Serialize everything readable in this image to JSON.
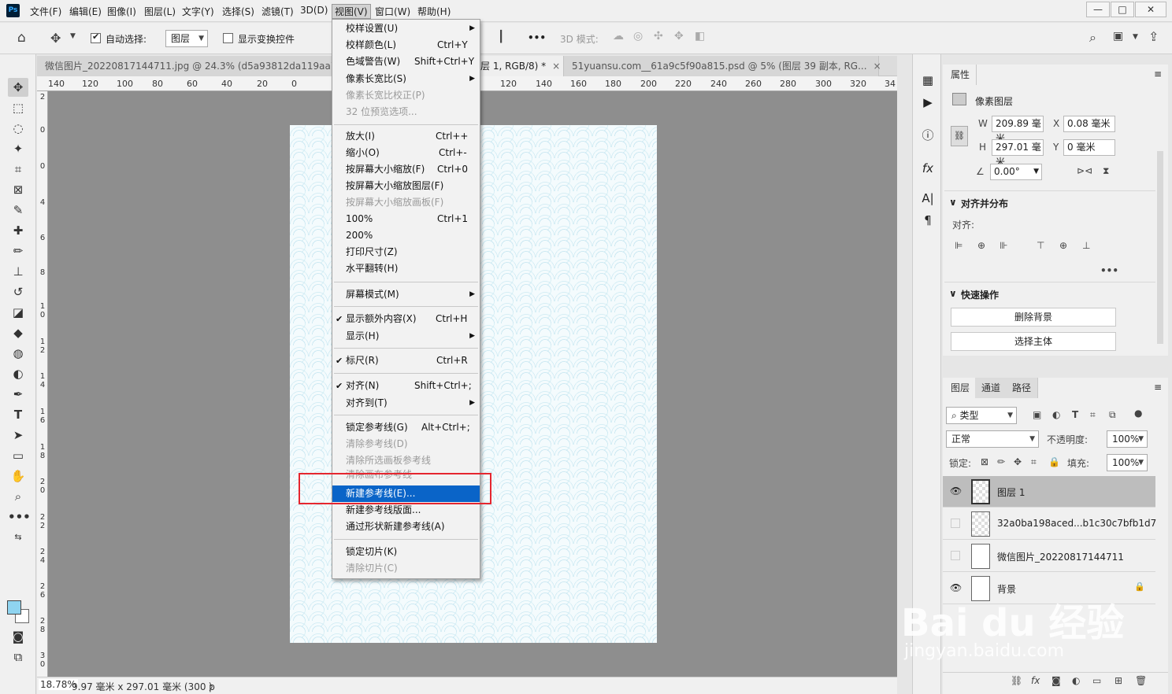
{
  "app": {
    "logo": "Ps"
  },
  "menubar": {
    "items": [
      "文件(F)",
      "编辑(E)",
      "图像(I)",
      "图层(L)",
      "文字(Y)",
      "选择(S)",
      "滤镜(T)",
      "3D(D)",
      "视图(V)",
      "窗口(W)",
      "帮助(H)"
    ],
    "active": "视图(V)"
  },
  "window_controls": {
    "minimize": "—",
    "maximize": "□",
    "close": "✕"
  },
  "options": {
    "move_icon": "✥",
    "auto_select_label": "自动选择:",
    "auto_select_value": "图层",
    "show_transform_label": "显示变换控件",
    "three_d_label": "3D 模式:",
    "more": "•••"
  },
  "tabs": [
    {
      "label": "微信图片_20220817144711.jpg @ 24.3% (d5a93812da119aa78...",
      "close": ""
    },
    {
      "label": "层 1, RGB/8) *",
      "close": "×"
    },
    {
      "label": "51yuansu.com__61a9c5f90a815.psd @ 5% (图层 39 副本, RG...",
      "close": "×"
    }
  ],
  "hruler": {
    "ticks_left": [
      "140",
      "120",
      "100",
      "80",
      "60",
      "40",
      "20",
      "0"
    ],
    "ticks_right": [
      "120",
      "140",
      "160",
      "180",
      "200",
      "220",
      "240",
      "260",
      "280",
      "300",
      "320",
      "34"
    ]
  },
  "vruler": {
    "ticks": [
      "2",
      "0",
      "0",
      "4",
      "6",
      "8",
      "1 0",
      "1 2",
      "1 4",
      "1 6",
      "1 8",
      "2 0",
      "2 2",
      "2 4",
      "2 6",
      "2 8",
      "3 0"
    ]
  },
  "status": {
    "zoom": "18.78%",
    "info": "9.97 毫米 x 297.01 毫米 (300 p",
    "arrow": "〉"
  },
  "view_menu": {
    "groups": [
      [
        {
          "label": "校样设置(U)",
          "shortcut": "",
          "submenu": true
        },
        {
          "label": "校样颜色(L)",
          "shortcut": "Ctrl+Y"
        },
        {
          "label": "色域警告(W)",
          "shortcut": "Shift+Ctrl+Y"
        },
        {
          "label": "像素长宽比(S)",
          "shortcut": "",
          "submenu": true
        },
        {
          "label": "像素长宽比校正(P)",
          "shortcut": "",
          "disabled": true
        },
        {
          "label": "32 位预览选项...",
          "shortcut": "",
          "disabled": true
        }
      ],
      [
        {
          "label": "放大(I)",
          "shortcut": "Ctrl++"
        },
        {
          "label": "缩小(O)",
          "shortcut": "Ctrl+-"
        },
        {
          "label": "按屏幕大小缩放(F)",
          "shortcut": "Ctrl+0"
        },
        {
          "label": "按屏幕大小缩放图层(F)",
          "shortcut": ""
        },
        {
          "label": "按屏幕大小缩放画板(F)",
          "shortcut": "",
          "disabled": true
        },
        {
          "label": "100%",
          "shortcut": "Ctrl+1"
        },
        {
          "label": "200%",
          "shortcut": ""
        },
        {
          "label": "打印尺寸(Z)",
          "shortcut": ""
        },
        {
          "label": "水平翻转(H)",
          "shortcut": ""
        }
      ],
      [
        {
          "label": "屏幕模式(M)",
          "shortcut": "",
          "submenu": true
        }
      ],
      [
        {
          "label": "显示额外内容(X)",
          "shortcut": "Ctrl+H",
          "checked": true
        },
        {
          "label": "显示(H)",
          "shortcut": "",
          "submenu": true
        }
      ],
      [
        {
          "label": "标尺(R)",
          "shortcut": "Ctrl+R",
          "checked": true
        }
      ],
      [
        {
          "label": "对齐(N)",
          "shortcut": "Shift+Ctrl+;",
          "checked": true
        },
        {
          "label": "对齐到(T)",
          "shortcut": "",
          "submenu": true
        }
      ],
      [
        {
          "label": "锁定参考线(G)",
          "shortcut": "Alt+Ctrl+;"
        },
        {
          "label": "清除参考线(D)",
          "shortcut": "",
          "disabled": true
        },
        {
          "label": "清除所选画板参考线",
          "shortcut": "",
          "disabled": true
        },
        {
          "label": "清除画布参考线",
          "shortcut": "",
          "disabled": true
        },
        {
          "label": "新建参考线(E)...",
          "shortcut": "",
          "highlighted": true
        },
        {
          "label": "新建参考线版面...",
          "shortcut": ""
        },
        {
          "label": "通过形状新建参考线(A)",
          "shortcut": ""
        }
      ],
      [
        {
          "label": "锁定切片(K)",
          "shortcut": ""
        },
        {
          "label": "清除切片(C)",
          "shortcut": "",
          "disabled": true
        }
      ]
    ]
  },
  "properties": {
    "tab": "属性",
    "type": "像素图层",
    "w_label": "W",
    "w": "209.89 毫米",
    "x_label": "X",
    "x": "0.08 毫米",
    "h_label": "H",
    "h": "297.01 毫米",
    "y_label": "Y",
    "y": "0 毫米",
    "angle": "0.00°",
    "align_title": "对齐并分布",
    "align_label": "对齐:",
    "align_more": "•••",
    "quick_title": "快速操作",
    "remove_bg": "删除背景",
    "select_subject": "选择主体"
  },
  "layers_panel": {
    "tabs": [
      "图层",
      "通道",
      "路径"
    ],
    "filter": "类型",
    "blend": "正常",
    "opacity_label": "不透明度:",
    "opacity": "100%",
    "lock_label": "锁定:",
    "fill_label": "填充:",
    "fill": "100%",
    "layers": [
      {
        "name": "图层 1",
        "visible": true,
        "selected": true
      },
      {
        "name": "32a0ba198aced...b1c30c7bfb1d7",
        "visible": false
      },
      {
        "name": "微信图片_20220817144711",
        "visible": false
      },
      {
        "name": "背景",
        "visible": true,
        "locked": true
      }
    ]
  },
  "watermark": {
    "brand": "Bai du 经验",
    "url": "jingyan.baidu.com"
  },
  "colors": {
    "highlight": "#0a64c8",
    "redbox": "#e5262f",
    "canvas_bg": "#8e8e8e",
    "foreground": "#8fd4f0"
  }
}
